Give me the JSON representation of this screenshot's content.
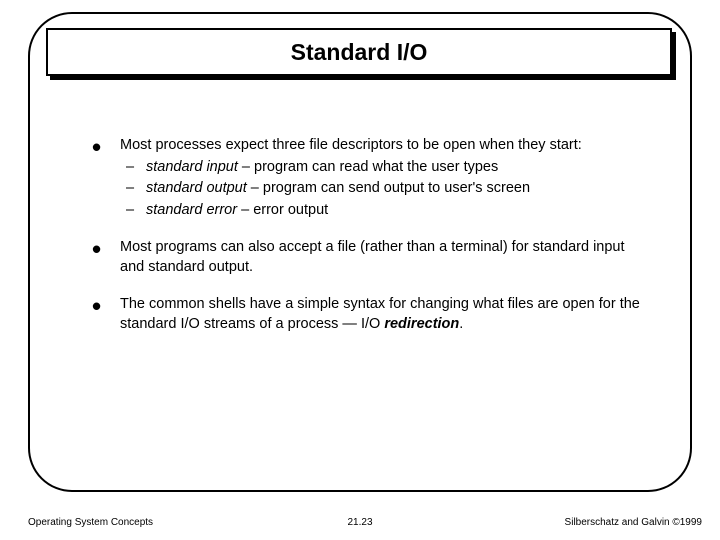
{
  "title": "Standard I/O",
  "bullets": [
    {
      "text": "Most processes expect three file descriptors to be open when they start:",
      "subs": [
        {
          "label": "standard input",
          "rest": " – program can read what the user types"
        },
        {
          "label": "standard output",
          "rest": " – program can send output to user's screen"
        },
        {
          "label": "standard error",
          "rest": " – error output"
        }
      ]
    },
    {
      "text": "Most programs can also accept a file (rather than a terminal) for standard input and standard output."
    },
    {
      "pre": "The common shells have a simple syntax for changing what files are open for the standard I/O streams of a process — I/O ",
      "em": "redirection",
      "post": "."
    }
  ],
  "footer": {
    "left": "Operating System Concepts",
    "center": "21.23",
    "right": "Silberschatz and Galvin ©1999"
  }
}
